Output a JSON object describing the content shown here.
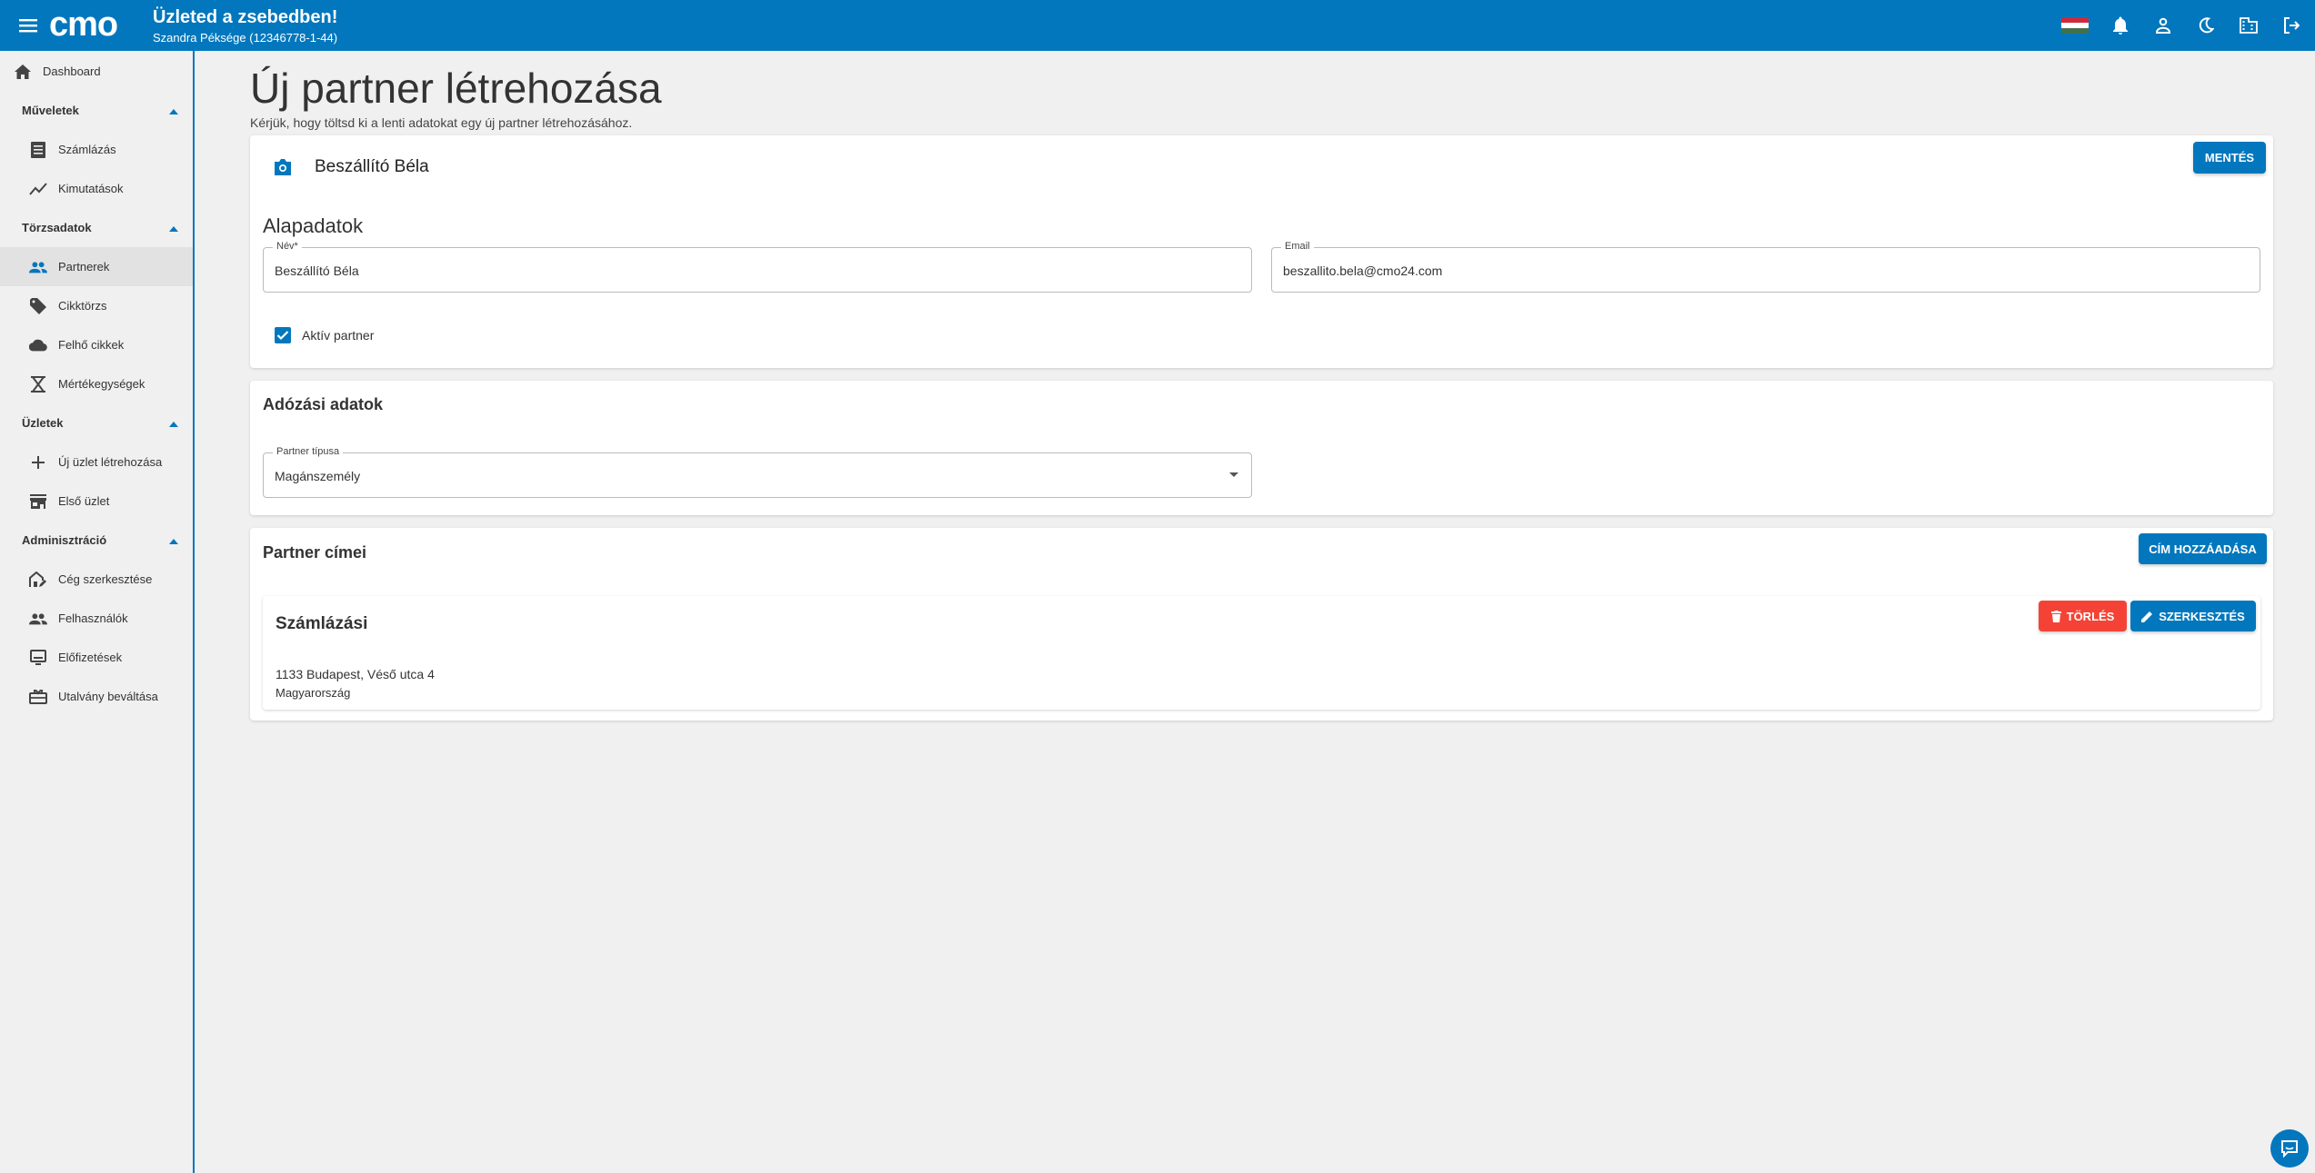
{
  "header": {
    "logo_text": "cmo",
    "title": "Üzleted a zsebedben!",
    "subtitle": "Szandra Péksége (12346778-1-44)",
    "icons": [
      "hungarian-flag-icon",
      "bell-icon",
      "person-icon",
      "moon-icon",
      "building-icon",
      "logout-icon"
    ]
  },
  "sidebar": {
    "dashboard": "Dashboard",
    "sections": {
      "muveletek": "Műveletek",
      "torzsadatok": "Törzsadatok",
      "uzletek": "Üzletek",
      "adminisztracio": "Adminisztráció"
    },
    "items": {
      "szamlazas": "Számlázás",
      "kimutatasok": "Kimutatások",
      "partnerek": "Partnerek",
      "cikktorzs": "Cikktörzs",
      "felho_cikkek": "Felhő cikkek",
      "mertekegysegek": "Mértékegységek",
      "uj_uzlet": "Új üzlet létrehozása",
      "elso_uzlet": "Első üzlet",
      "ceg_szerkesztese": "Cég szerkesztése",
      "felhasznalok": "Felhasználók",
      "elofizetesek": "Előfizetések",
      "utalvany": "Utalvány beváltása"
    },
    "active": "Partnerek"
  },
  "page": {
    "title": "Új partner létrehozása",
    "subtitle": "Kérjük, hogy töltsd ki a lenti adatokat egy új partner létrehozásához."
  },
  "basic_card": {
    "partner_name": "Beszállító Béla",
    "save_button": "MENTÉS",
    "section_title": "Alapadatok",
    "name_label": "Név*",
    "name_value": "Beszállító Béla",
    "email_label": "Email",
    "email_value": "beszallito.bela@cmo24.com",
    "active_label": "Aktív partner",
    "active_checked": true
  },
  "tax_card": {
    "section_title": "Adózási adatok",
    "type_label": "Partner típusa",
    "type_value": "Magánszemély"
  },
  "address_card": {
    "section_title": "Partner címei",
    "add_button": "CÍM HOZZÁADÁSA",
    "addresses": [
      {
        "type": "Számlázási",
        "line1": "1133 Budapest, Véső utca 4",
        "line2": "Magyarország",
        "delete_label": "TÖRLÉS",
        "edit_label": "SZERKESZTÉS"
      }
    ]
  },
  "colors": {
    "primary": "#0277bd",
    "danger": "#f44336",
    "background": "#f0f0f0"
  }
}
